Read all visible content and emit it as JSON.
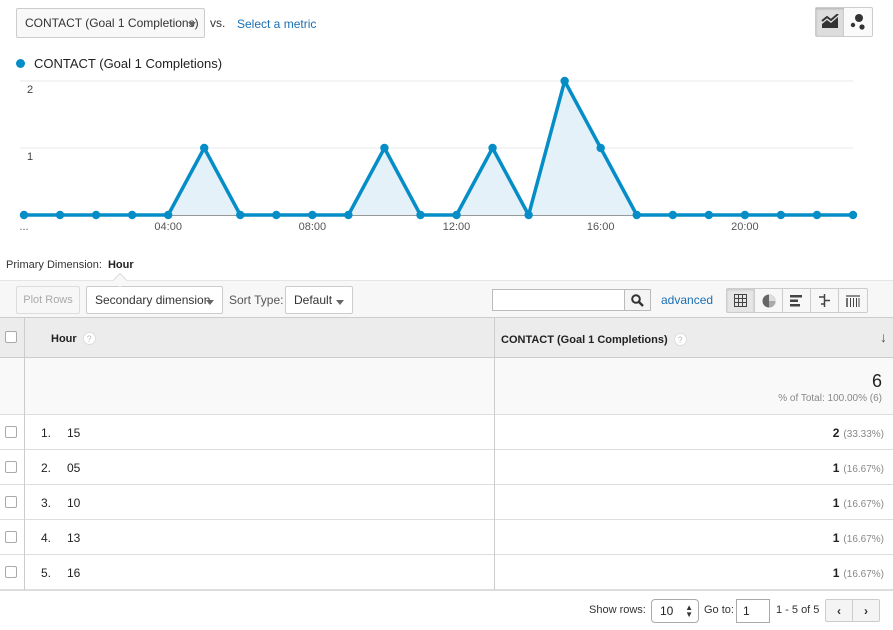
{
  "header": {
    "metric_select": "CONTACT (Goal 1 Completions)",
    "vs_label": "vs.",
    "select_metric_link": "Select a metric",
    "chart_type_buttons": [
      {
        "icon": "line-chart-icon",
        "active": true
      },
      {
        "icon": "motion-chart-icon",
        "active": false
      }
    ]
  },
  "chart_data": {
    "type": "line",
    "title": "",
    "legend": [
      "CONTACT (Goal 1 Completions)"
    ],
    "legend_position": "top-left",
    "series": [
      {
        "name": "CONTACT (Goal 1 Completions)",
        "color": "#058dc7",
        "values": [
          0,
          0,
          0,
          0,
          0,
          1,
          0,
          0,
          0,
          0,
          1,
          0,
          0,
          1,
          0,
          2,
          1,
          0,
          0,
          0,
          0,
          0,
          0,
          0
        ]
      }
    ],
    "x": [
      0,
      1,
      2,
      3,
      4,
      5,
      6,
      7,
      8,
      9,
      10,
      11,
      12,
      13,
      14,
      15,
      16,
      17,
      18,
      19,
      20,
      21,
      22,
      23
    ],
    "x_tick_labels": [
      {
        "x": 0,
        "label": "..."
      },
      {
        "x": 4,
        "label": "04:00"
      },
      {
        "x": 8,
        "label": "08:00"
      },
      {
        "x": 12,
        "label": "12:00"
      },
      {
        "x": 16,
        "label": "16:00"
      },
      {
        "x": 20,
        "label": "20:00"
      }
    ],
    "y_ticks": [
      1,
      2
    ],
    "ylim": [
      0,
      2
    ],
    "xlabel": "",
    "ylabel": "",
    "grid": true,
    "fill": true
  },
  "primary_dimension": {
    "label": "Primary Dimension:",
    "value": "Hour"
  },
  "toolbar": {
    "plot_rows": "Plot Rows",
    "secondary_dimension": "Secondary dimension",
    "sort_type_label": "Sort Type:",
    "sort_type_value": "Default",
    "search_value": "",
    "advanced": "advanced",
    "view_buttons": [
      "table-view-icon",
      "pie-view-icon",
      "bar-view-icon",
      "comparison-view-icon",
      "pivot-view-icon"
    ]
  },
  "table": {
    "headers": {
      "dimension": "Hour",
      "metric": "CONTACT (Goal 1 Completions)",
      "help": "?",
      "sort": "↓"
    },
    "totals": {
      "value": "6",
      "pct": "% of Total: 100.00% (6)"
    },
    "rows": [
      {
        "index": "1.",
        "hour": "15",
        "value": "2",
        "pct": "(33.33%)"
      },
      {
        "index": "2.",
        "hour": "05",
        "value": "1",
        "pct": "(16.67%)"
      },
      {
        "index": "3.",
        "hour": "10",
        "value": "1",
        "pct": "(16.67%)"
      },
      {
        "index": "4.",
        "hour": "13",
        "value": "1",
        "pct": "(16.67%)"
      },
      {
        "index": "5.",
        "hour": "16",
        "value": "1",
        "pct": "(16.67%)"
      }
    ]
  },
  "pagination": {
    "show_rows_label": "Show rows:",
    "show_rows_value": "10",
    "goto_label": "Go to:",
    "goto_value": "1",
    "range": "1 - 5 of 5",
    "prev": "‹",
    "next": "›"
  }
}
